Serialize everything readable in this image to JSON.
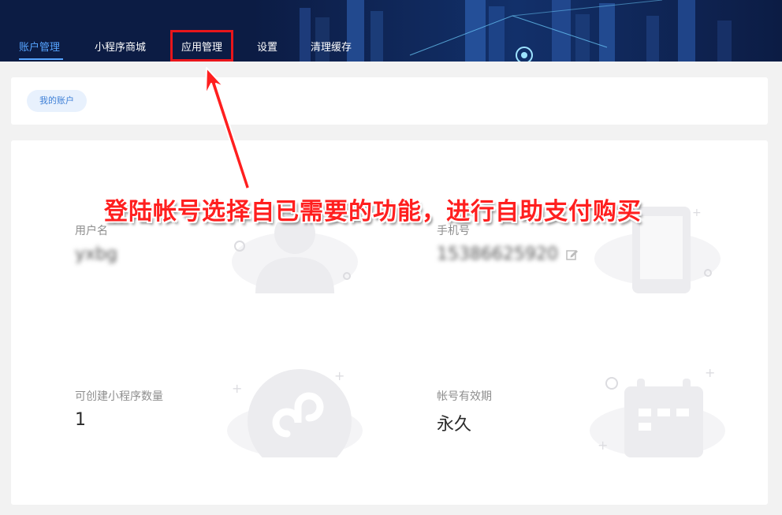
{
  "nav": {
    "items": [
      {
        "label": "账户管理",
        "active": true
      },
      {
        "label": "小程序商城",
        "active": false
      },
      {
        "label": "应用管理",
        "active": false
      },
      {
        "label": "设置",
        "active": false
      },
      {
        "label": "清理缓存",
        "active": false
      }
    ],
    "active_color": "#56a4ff",
    "highlight_color": "#e8161b"
  },
  "breadcrumb": {
    "label": "我的账户"
  },
  "account": {
    "username_label": "用户名",
    "username_value": "yxbg",
    "phone_label": "手机号",
    "phone_value": "15386625920",
    "miniprogram_label": "可创建小程序数量",
    "miniprogram_value": "1",
    "validity_label": "帐号有效期",
    "validity_value": "永久"
  },
  "annotation": {
    "text": "登陆帐号选择自已需要的功能，进行自助支付购买",
    "color": "#ff1f1f"
  },
  "icons": [
    "user-illustration-icon",
    "phone-illustration-icon",
    "edit-icon",
    "miniprogram-illustration-icon",
    "calendar-illustration-icon"
  ]
}
